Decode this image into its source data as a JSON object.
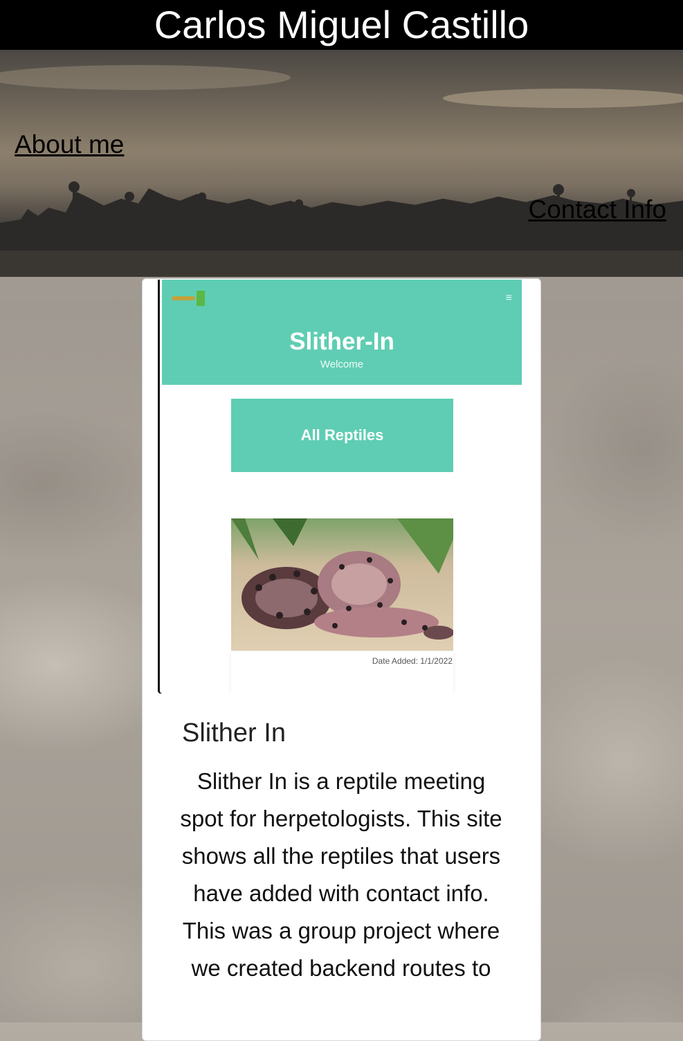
{
  "header": {
    "title": "Carlos Miguel Castillo"
  },
  "nav": {
    "about_label": "About me",
    "contact_label": "Contact Info"
  },
  "project": {
    "screenshot": {
      "app_title": "Slither-In",
      "app_subtitle": "Welcome",
      "button_label": "All Reptiles",
      "date_text": "Date Added: 1/1/2022",
      "menu_icon": "hamburger-icon",
      "theme_color": "#5fcdb3"
    },
    "title": "Slither In",
    "description": "Slither In is a reptile meeting spot for herpetologists. This site shows all the reptiles that users have added with contact info. This was a group project where we created backend routes to"
  }
}
